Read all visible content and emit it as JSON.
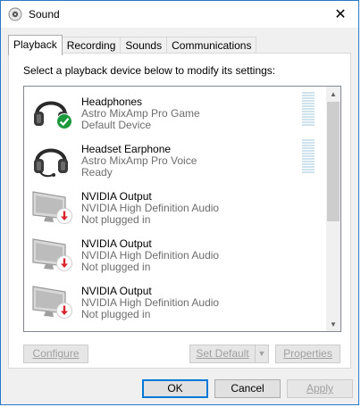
{
  "window": {
    "title": "Sound",
    "close_glyph": "✕"
  },
  "tabs": [
    {
      "label": "Playback",
      "active": true
    },
    {
      "label": "Recording",
      "active": false
    },
    {
      "label": "Sounds",
      "active": false
    },
    {
      "label": "Communications",
      "active": false
    }
  ],
  "prompt": "Select a playback device below to modify its settings:",
  "devices": [
    {
      "name": "Headphones",
      "description": "Astro MixAmp Pro Game",
      "status": "Default Device",
      "icon": "headphones-icon",
      "badge": "default-check-icon",
      "meter": true
    },
    {
      "name": "Headset Earphone",
      "description": "Astro MixAmp Pro Voice",
      "status": "Ready",
      "icon": "headset-icon",
      "badge": "",
      "meter": true
    },
    {
      "name": "NVIDIA Output",
      "description": "NVIDIA High Definition Audio",
      "status": "Not plugged in",
      "icon": "monitor-icon",
      "badge": "unplugged-arrow-icon",
      "meter": false
    },
    {
      "name": "NVIDIA Output",
      "description": "NVIDIA High Definition Audio",
      "status": "Not plugged in",
      "icon": "monitor-icon",
      "badge": "unplugged-arrow-icon",
      "meter": false
    },
    {
      "name": "NVIDIA Output",
      "description": "NVIDIA High Definition Audio",
      "status": "Not plugged in",
      "icon": "monitor-icon",
      "badge": "unplugged-arrow-icon",
      "meter": false
    }
  ],
  "buttons": {
    "configure": "Configure",
    "set_default": "Set Default",
    "properties": "Properties",
    "ok": "OK",
    "cancel": "Cancel",
    "apply": "Apply"
  },
  "colors": {
    "accent": "#0078d7",
    "check_green": "#1a9a3a",
    "unplugged_red": "#d9232e"
  }
}
